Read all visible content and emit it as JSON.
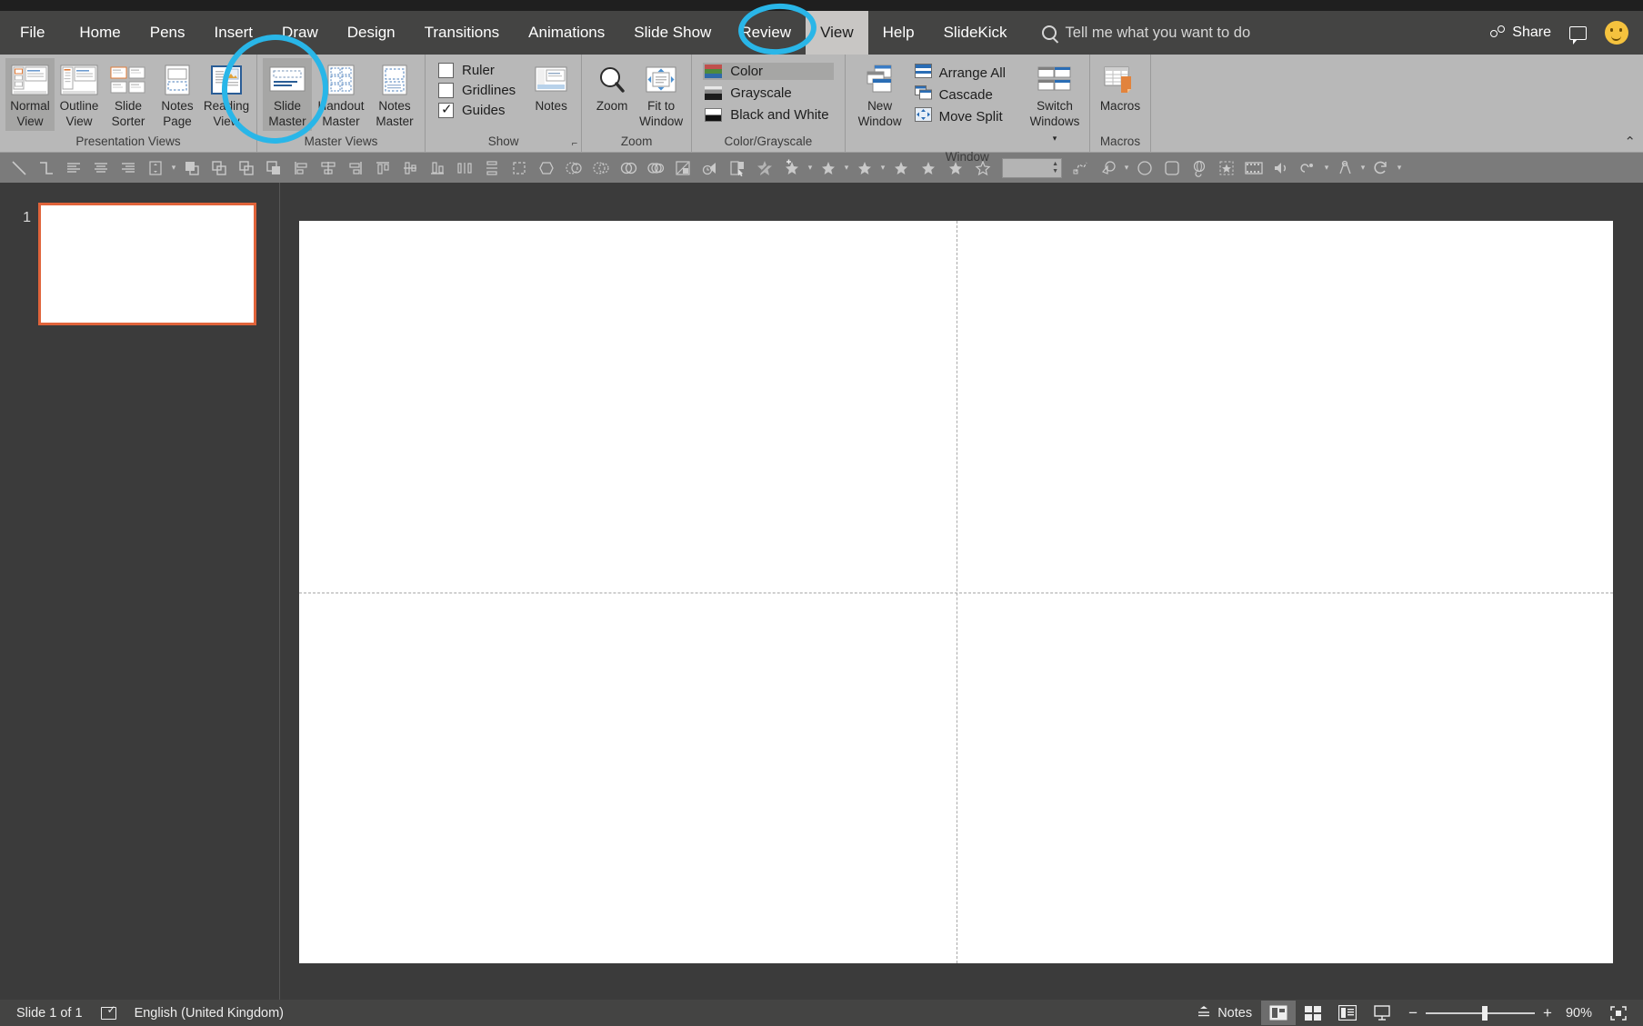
{
  "app": {
    "tabs": [
      {
        "id": "file",
        "label": "File",
        "selected": false
      },
      {
        "id": "home",
        "label": "Home",
        "selected": false
      },
      {
        "id": "pens",
        "label": "Pens",
        "selected": false
      },
      {
        "id": "insert",
        "label": "Insert",
        "selected": false
      },
      {
        "id": "draw",
        "label": "Draw",
        "selected": false
      },
      {
        "id": "design",
        "label": "Design",
        "selected": false
      },
      {
        "id": "transitions",
        "label": "Transitions",
        "selected": false
      },
      {
        "id": "animations",
        "label": "Animations",
        "selected": false
      },
      {
        "id": "slideshow",
        "label": "Slide Show",
        "selected": false
      },
      {
        "id": "review",
        "label": "Review",
        "selected": false
      },
      {
        "id": "view",
        "label": "View",
        "selected": true
      },
      {
        "id": "help",
        "label": "Help",
        "selected": false
      },
      {
        "id": "slidekick",
        "label": "SlideKick",
        "selected": false
      }
    ],
    "search": {
      "placeholder": "Tell me what you want to do"
    },
    "share_label": "Share"
  },
  "ribbon": {
    "groups": [
      {
        "id": "presentation-views",
        "label": "Presentation Views",
        "buttons": [
          {
            "id": "normal",
            "label": "Normal\nView",
            "line1": "Normal",
            "line2": "View",
            "selected": true
          },
          {
            "id": "outline-view",
            "label": "Outline View",
            "line1": "Outline",
            "line2": "View",
            "selected": false
          },
          {
            "id": "slide-sorter",
            "label": "Slide Sorter",
            "line1": "Slide",
            "line2": "Sorter",
            "selected": false
          },
          {
            "id": "notes-page",
            "label": "Notes Page",
            "line1": "Notes",
            "line2": "Page",
            "selected": false
          },
          {
            "id": "reading-view",
            "label": "Reading View",
            "line1": "Reading",
            "line2": "View",
            "selected": false
          }
        ]
      },
      {
        "id": "master-views",
        "label": "Master Views",
        "buttons": [
          {
            "id": "slide-master",
            "label": "Slide Master",
            "line1": "Slide",
            "line2": "Master",
            "selected": true
          },
          {
            "id": "handout-master",
            "label": "Handout Master",
            "line1": "Handout",
            "line2": "Master",
            "selected": false
          },
          {
            "id": "notes-master",
            "label": "Notes Master",
            "line1": "Notes",
            "line2": "Master",
            "selected": false
          }
        ]
      },
      {
        "id": "show",
        "label": "Show",
        "checkboxes": [
          {
            "id": "ruler",
            "label": "Ruler",
            "checked": false
          },
          {
            "id": "gridlines",
            "label": "Gridlines",
            "checked": false
          },
          {
            "id": "guides",
            "label": "Guides",
            "checked": true
          }
        ],
        "buttons": [
          {
            "id": "notes",
            "label": "Notes",
            "line1": "Notes",
            "line2": "",
            "selected": false
          }
        ]
      },
      {
        "id": "zoom",
        "label": "Zoom",
        "buttons": [
          {
            "id": "zoom",
            "label": "Zoom",
            "line1": "Zoom",
            "line2": "",
            "selected": false
          },
          {
            "id": "fit-to-window",
            "label": "Fit to Window",
            "line1": "Fit to",
            "line2": "Window",
            "selected": false
          }
        ]
      },
      {
        "id": "color-grayscale",
        "label": "Color/Grayscale",
        "options": [
          {
            "id": "color",
            "label": "Color",
            "swatch": "sw-color",
            "selected": true
          },
          {
            "id": "grayscale",
            "label": "Grayscale",
            "swatch": "sw-gray",
            "selected": false
          },
          {
            "id": "black-and-white",
            "label": "Black and White",
            "swatch": "sw-bw",
            "selected": false
          }
        ]
      },
      {
        "id": "window",
        "label": "Window",
        "buttons": [
          {
            "id": "new-window",
            "label": "New Window",
            "line1": "New",
            "line2": "Window",
            "selected": false
          },
          {
            "id": "switch-windows",
            "label": "Switch Windows",
            "line1": "Switch",
            "line2": "Windows",
            "selected": false
          }
        ],
        "items": [
          {
            "id": "arrange-all",
            "label": "Arrange All"
          },
          {
            "id": "cascade",
            "label": "Cascade"
          },
          {
            "id": "move-split",
            "label": "Move Split"
          }
        ]
      },
      {
        "id": "macros",
        "label": "Macros",
        "buttons": [
          {
            "id": "macros",
            "label": "Macros",
            "line1": "Macros",
            "line2": "",
            "selected": false
          }
        ]
      }
    ]
  },
  "slide_pane": {
    "thumbnail_number": "1"
  },
  "status": {
    "slide_count": "Slide 1 of 1",
    "language": "English (United Kingdom)",
    "notes_label": "Notes",
    "zoom_level": "90%",
    "zoom_minus": "−",
    "zoom_plus": "+"
  },
  "colors": {
    "accent_annotation": "#29b6e8",
    "ribbon_bg": "#b8b8b8",
    "tabbar_bg": "#444443",
    "workspace_bg": "#3b3b3b",
    "thumb_selected_border": "#e0633a"
  }
}
